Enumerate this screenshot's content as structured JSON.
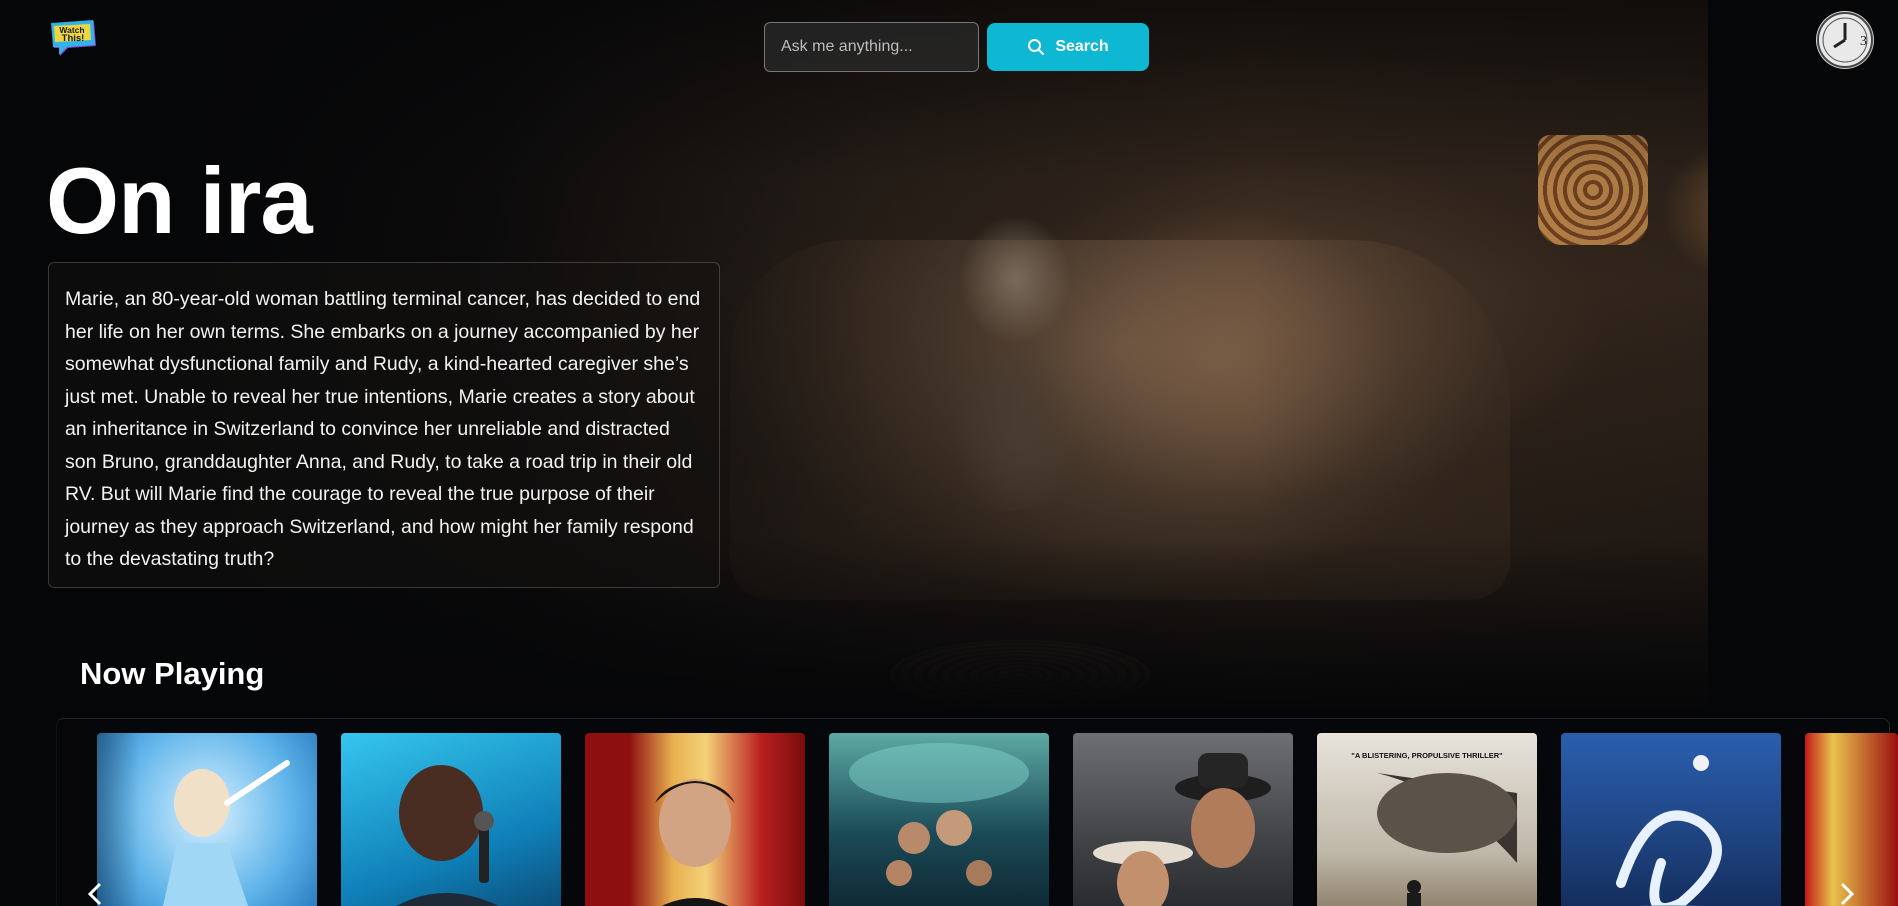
{
  "header": {
    "logo_text": "Watch This!",
    "search": {
      "placeholder": "Ask me anything...",
      "value": ""
    },
    "search_button_label": "Search",
    "avatar_badge": "3"
  },
  "hero": {
    "title": "On ira",
    "description": "Marie, an 80-year-old woman battling terminal cancer, has decided to end her life on her own terms. She embarks on a journey accompanied by her somewhat dysfunctional family and Rudy, a kind-hearted caregiver she’s just met. Unable to reveal her true intentions, Marie creates a story about an inheritance in Switzerland to convince her unreliable and distracted son Bruno, granddaughter Anna, and Rudy, to take a road trip in their old RV. But will Marie find the courage to reveal the true purpose of their journey as they approach Switzerland, and how might her family respond to the devastating truth?"
  },
  "now_playing": {
    "heading": "Now Playing",
    "posters": [
      {
        "name": "poster-frozen",
        "caption": ""
      },
      {
        "name": "poster-comedian-mic",
        "caption": ""
      },
      {
        "name": "poster-comedian-curtain",
        "caption": ""
      },
      {
        "name": "poster-family-adventure",
        "caption": ""
      },
      {
        "name": "poster-cowboys",
        "caption": ""
      },
      {
        "name": "poster-thriller",
        "caption": "\"A BLISTERING, PROPULSIVE THRILLER\""
      },
      {
        "name": "poster-neverending-story",
        "caption": ""
      },
      {
        "name": "poster-partial",
        "caption": ""
      }
    ],
    "prev_icon": "chevron-left-icon",
    "next_icon": "chevron-right-icon"
  },
  "colors": {
    "accent": "#0eb8d2",
    "background": "#050608"
  }
}
